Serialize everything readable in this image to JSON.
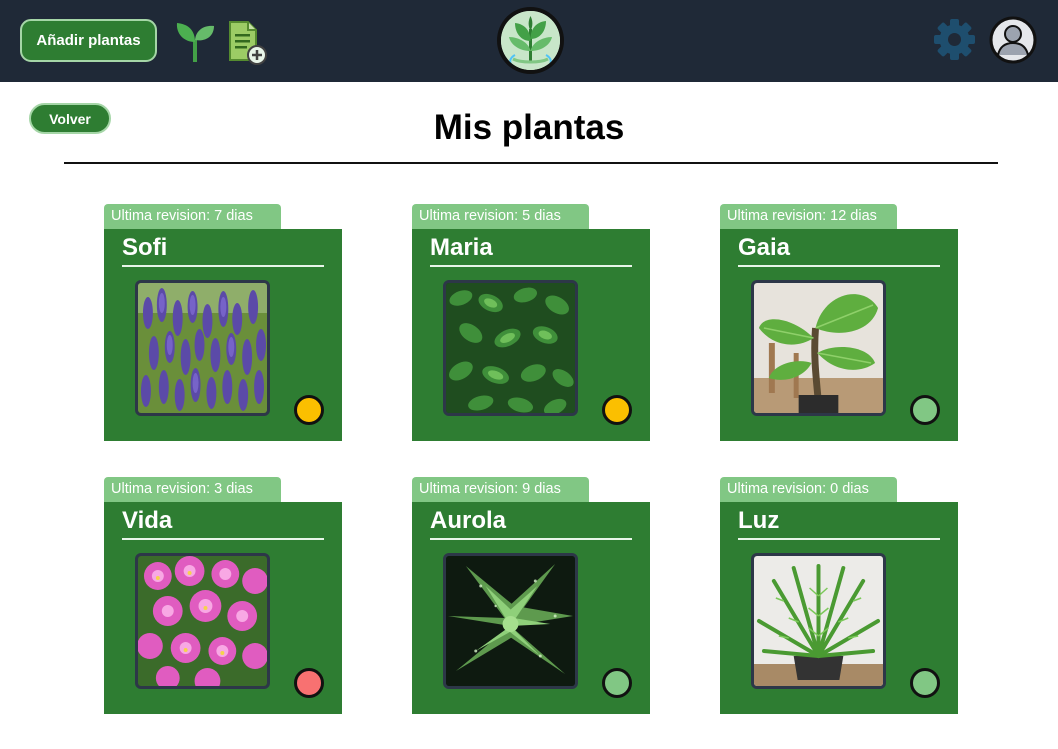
{
  "header": {
    "add_button_label": "Añadir plantas",
    "icons": [
      "sprout-icon",
      "document-add-icon",
      "logo",
      "gear-icon",
      "avatar-icon"
    ]
  },
  "page": {
    "back_label": "Volver",
    "title": "Mis plantas"
  },
  "colors": {
    "topbar": "#1f2937",
    "primary_green": "#2e7d32",
    "light_green": "#81c784",
    "status_warning": "#fbbf00",
    "status_ok": "#81c784",
    "status_alert": "#f87171",
    "gear": "#1e4e6e"
  },
  "plants": [
    {
      "revision": "Ultima revision: 7 dias",
      "name": "Sofi",
      "photo": "lavender",
      "status": "warning",
      "status_color": "#fbbf00"
    },
    {
      "revision": "Ultima revision: 5 dias",
      "name": "Maria",
      "photo": "mint",
      "status": "warning",
      "status_color": "#fbbf00"
    },
    {
      "revision": "Ultima revision: 12 dias",
      "name": "Gaia",
      "photo": "alocasia",
      "status": "ok",
      "status_color": "#81c784"
    },
    {
      "revision": "Ultima revision: 3 dias",
      "name": "Vida",
      "photo": "orchid",
      "status": "alert",
      "status_color": "#f87171"
    },
    {
      "revision": "Ultima revision: 9 dias",
      "name": "Aurola",
      "photo": "succulent",
      "status": "ok",
      "status_color": "#81c784"
    },
    {
      "revision": "Ultima revision: 0 dias",
      "name": "Luz",
      "photo": "fern",
      "status": "ok",
      "status_color": "#81c784"
    }
  ]
}
